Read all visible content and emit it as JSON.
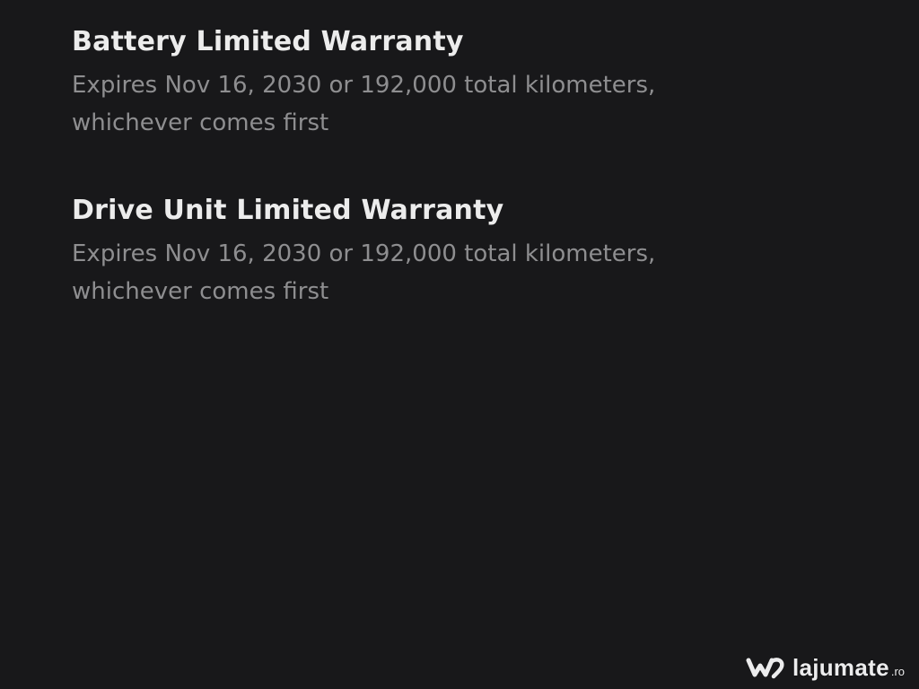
{
  "warranties": [
    {
      "title": "Battery Limited Warranty",
      "description": "Expires Nov 16, 2030 or 192,000 total kilometers, whichever comes first"
    },
    {
      "title": "Drive Unit Limited Warranty",
      "description": "Expires Nov 16, 2030 or 192,000 total kilometers, whichever comes first"
    }
  ],
  "watermark": {
    "icon": "lajumate-logo-icon",
    "name": "lajumate",
    "tld": ".ro"
  },
  "colors": {
    "background": "#18181a",
    "title": "#ececec",
    "description": "#8e8e90"
  }
}
